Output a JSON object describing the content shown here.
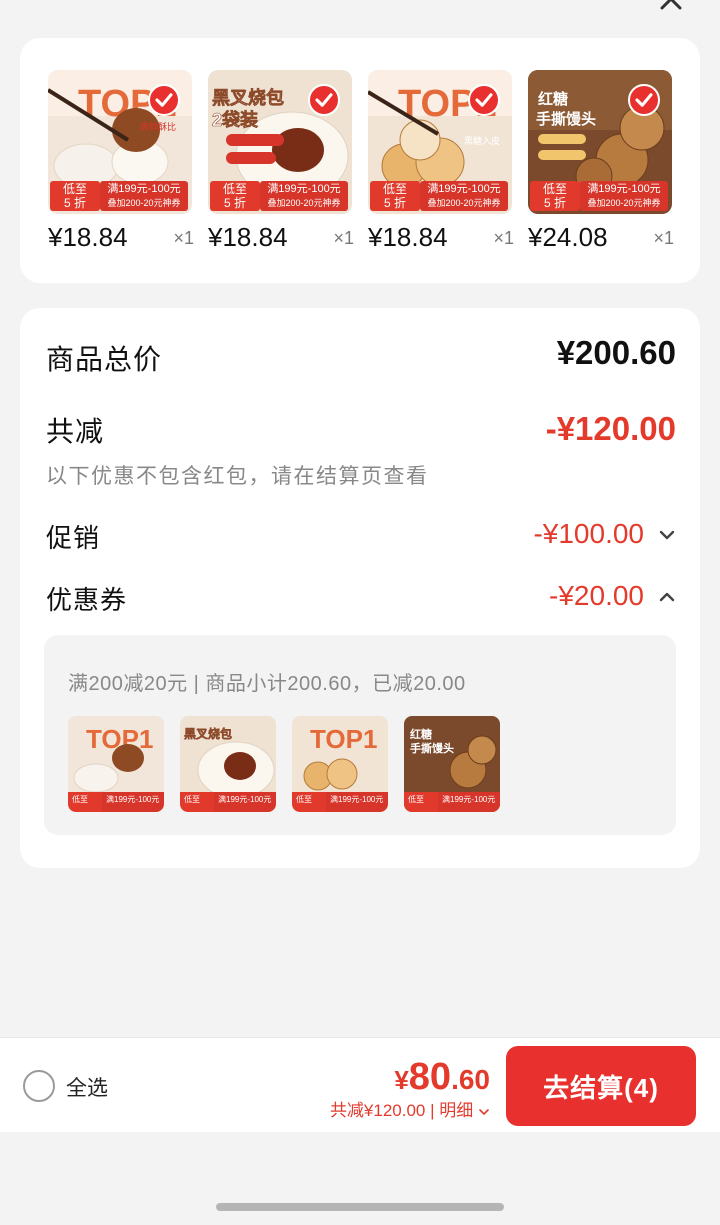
{
  "header": {
    "title": ""
  },
  "products": [
    {
      "name": "TOP1 bun",
      "price": "¥18.84",
      "qty": "×1",
      "low_badge": "低至\n5 折",
      "promo_line1": "满199元-100元",
      "promo_line2": "叠加200-20元神券",
      "theme": "bun-top1"
    },
    {
      "name": "叉烧包 2袋装",
      "price": "¥18.84",
      "qty": "×1",
      "low_badge": "低至\n5 折",
      "promo_line1": "满199元-100元",
      "promo_line2": "叠加200-20元神券",
      "theme": "char-siu"
    },
    {
      "name": "TOP1 heidou",
      "price": "¥18.84",
      "qty": "×1",
      "low_badge": "低至\n5 折",
      "promo_line1": "满199元-100元",
      "promo_line2": "叠加200-20元神券",
      "theme": "bun-top1b"
    },
    {
      "name": "红糖手撕馒头",
      "price": "¥24.08",
      "qty": "×1",
      "low_badge": "低至\n5 折",
      "promo_line1": "满199元-100元",
      "promo_line2": "叠加200-20元神券",
      "theme": "brown-sugar"
    }
  ],
  "summary": {
    "total_label": "商品总价",
    "total_value": "¥200.60",
    "reduce_label": "共减",
    "reduce_value": "-¥120.00",
    "note": "以下优惠不包含红包，请在结算页查看",
    "promo_label": "促销",
    "promo_value": "-¥100.00",
    "coupon_label": "优惠券",
    "coupon_value": "-¥20.00",
    "coupon_detail": "满200减20元 | 商品小计200.60，已减20.00"
  },
  "bottom": {
    "select_all": "全选",
    "price_symbol": "¥",
    "price_int": "80",
    "price_dec": ".60",
    "reduced_text": "共减¥120.00 | 明细",
    "checkout_label": "去结算(4)"
  },
  "colors": {
    "accent": "#e8312e",
    "price_red": "#e33a2c"
  }
}
